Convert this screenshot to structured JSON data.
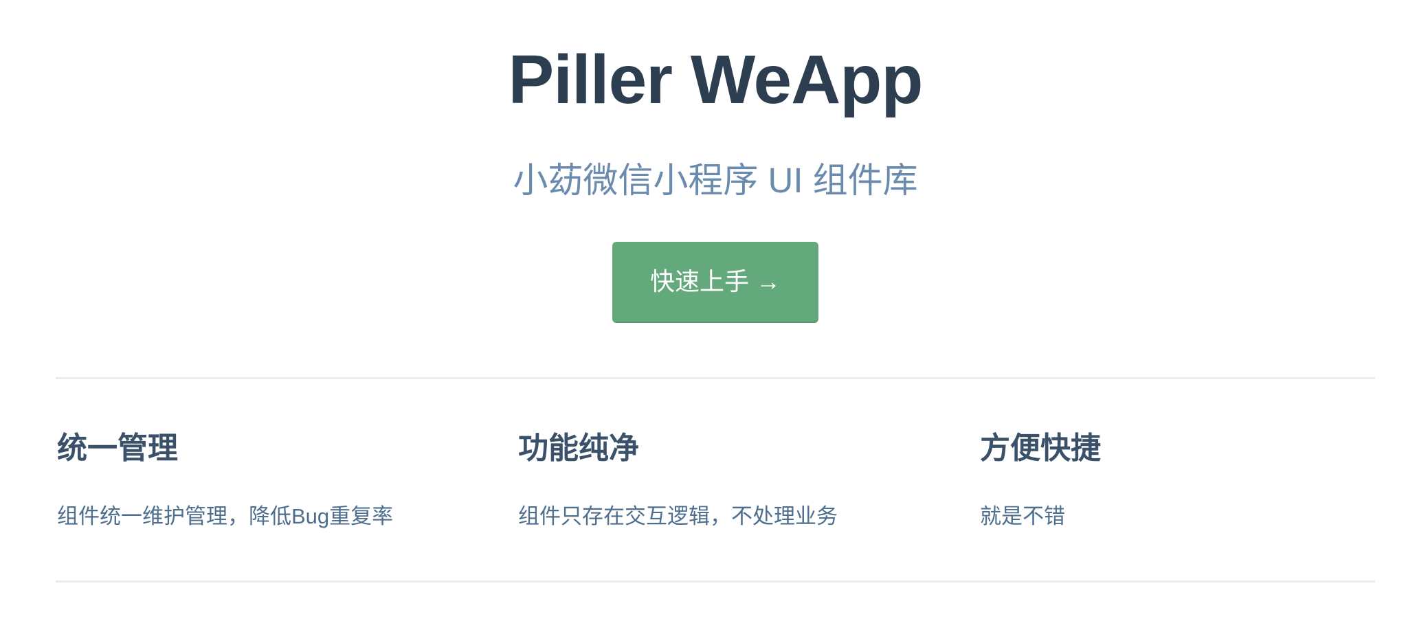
{
  "hero": {
    "title": "Piller WeApp",
    "description": "小苭微信小程序 UI 组件库",
    "action_label": "快速上手 →"
  },
  "features": [
    {
      "title": "统一管理",
      "details": "组件统一维护管理，降低Bug重复率"
    },
    {
      "title": "功能纯净",
      "details": "组件只存在交互逻辑，不处理业务"
    },
    {
      "title": "方便快捷",
      "details": "就是不错"
    }
  ],
  "colors": {
    "title": "#2c3e50",
    "description": "#6a8bad",
    "accent": "#63a97b",
    "divider": "#eaecef"
  }
}
